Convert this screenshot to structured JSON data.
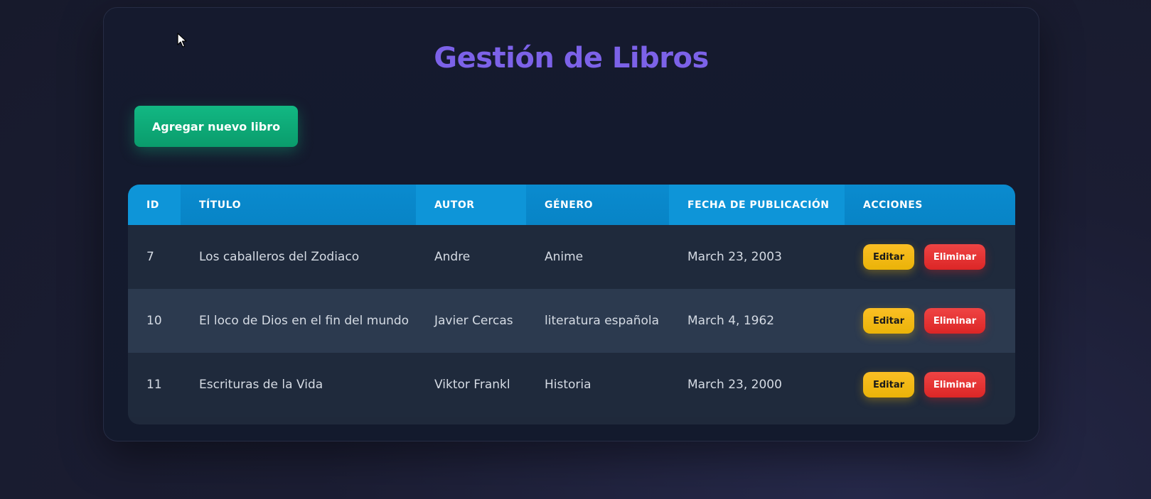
{
  "page": {
    "title": "Gestión de Libros",
    "add_button_label": "Agregar nuevo libro"
  },
  "table": {
    "headers": [
      "ID",
      "TÍTULO",
      "AUTOR",
      "GÉNERO",
      "FECHA DE PUBLICACIÓN",
      "ACCIONES"
    ],
    "rows": [
      {
        "id": "7",
        "titulo": "Los caballeros del Zodiaco",
        "autor": "Andre",
        "genero": "Anime",
        "fecha": "March 23, 2003"
      },
      {
        "id": "10",
        "titulo": "El loco de Dios en el fin del mundo",
        "autor": "Javier Cercas",
        "genero": "literatura española",
        "fecha": "March 4, 1962"
      },
      {
        "id": "11",
        "titulo": "Escrituras de la Vida",
        "autor": "Viktor Frankl",
        "genero": "Historia",
        "fecha": "March 23, 2000"
      }
    ],
    "edit_label": "Editar",
    "delete_label": "Eliminar"
  },
  "colors": {
    "title": "#7c62e8",
    "add_button": "#10b981",
    "header": "#0e95d8",
    "edit_button": "#fbbf24",
    "delete_button": "#ef4444"
  },
  "icons": {
    "cursor": "mouse-pointer-icon"
  }
}
